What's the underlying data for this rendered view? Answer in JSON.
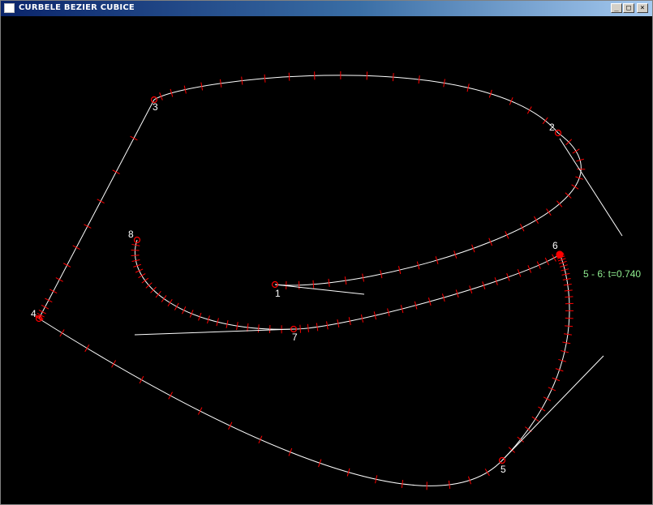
{
  "window": {
    "title": "CURBELE BEZIER CUBICE"
  },
  "controls": {
    "minimize": "_",
    "maximize": "□",
    "close": "×"
  },
  "colors": {
    "background": "#000000",
    "curve": "#ffffff",
    "tick": "#ff0000",
    "point": "#ff0000",
    "point_label": "#ffffff",
    "param_text": "#90ee90"
  },
  "points": [
    {
      "label": "1"
    },
    {
      "label": "2"
    },
    {
      "label": "3"
    },
    {
      "label": "4"
    },
    {
      "label": "5"
    },
    {
      "label": "6"
    },
    {
      "label": "7"
    },
    {
      "label": "8"
    }
  ],
  "status": {
    "param_text": "5 - 6:  t=0.740"
  }
}
